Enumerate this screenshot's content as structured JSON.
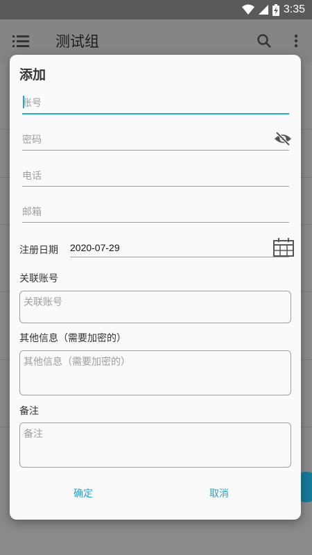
{
  "status_bar": {
    "time": "3:35",
    "icons": [
      "wifi-icon",
      "signal-icon",
      "battery-charging-icon"
    ]
  },
  "app_bar": {
    "title": "测试组",
    "icons": [
      "menu-icon",
      "search-icon",
      "more-vert-icon"
    ]
  },
  "dialog": {
    "title": "添加",
    "account": {
      "placeholder": "账号",
      "value": ""
    },
    "password": {
      "placeholder": "密码",
      "value": ""
    },
    "phone": {
      "placeholder": "电话",
      "value": ""
    },
    "email": {
      "placeholder": "邮箱",
      "value": ""
    },
    "register_date": {
      "label": "注册日期",
      "value": "2020-07-29"
    },
    "linked_account": {
      "label": "关联账号",
      "placeholder": "关联账号"
    },
    "other_info": {
      "label": "其他信息（需要加密的）",
      "placeholder": "其他信息（需要加密的）"
    },
    "notes": {
      "label": "备注",
      "placeholder": "备注"
    },
    "confirm_label": "确定",
    "cancel_label": "取消"
  },
  "colors": {
    "accent": "#26a8c8",
    "scrim": "#8a8a8a",
    "dialog_bg": "#fafafa"
  }
}
